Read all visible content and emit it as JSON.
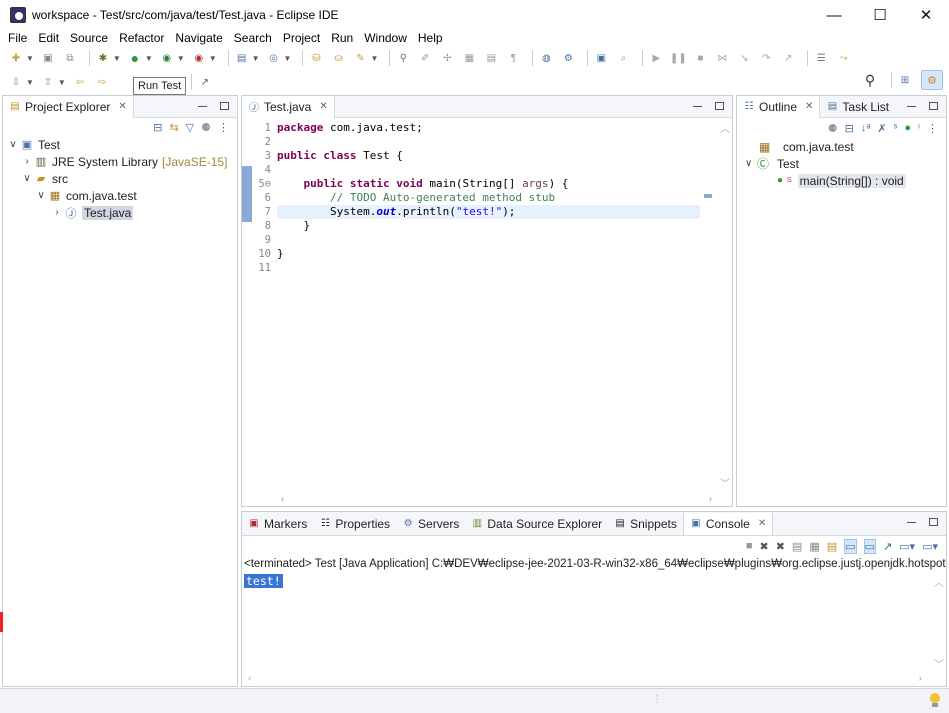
{
  "window": {
    "title": "workspace - Test/src/com/java/test/Test.java - Eclipse IDE",
    "minimize": "—",
    "maximize": "☐",
    "close": "✕"
  },
  "menu": [
    "File",
    "Edit",
    "Source",
    "Refactor",
    "Navigate",
    "Search",
    "Project",
    "Run",
    "Window",
    "Help"
  ],
  "tooltip": "Run Test",
  "project_explorer": {
    "tab_label": "Project Explorer",
    "tree": {
      "project": "Test",
      "jre": "JRE System Library",
      "jre_decoration": "[JavaSE-15]",
      "src": "src",
      "package": "com.java.test",
      "file": "Test.java"
    }
  },
  "editor": {
    "tab_label": "Test.java",
    "line_numbers": [
      "1",
      "2",
      "3",
      "4",
      "5⊖",
      "6",
      "7",
      "8",
      "9",
      "10",
      "11"
    ],
    "lines": {
      "l1_kw": "package",
      "l1_rest": " com.java.test;",
      "l3_kw": "public class",
      "l3_rest": " Test {",
      "l5_indent": "    ",
      "l5_kw": "public static void",
      "l5_rest": " main(String[] ",
      "l5_arg": "args",
      "l5_end": ") {",
      "l6_comment": "        // TODO Auto-generated method stub",
      "l7_pre": "        System.",
      "l7_out": "out",
      "l7_mid": ".println(",
      "l7_str": "\"test!\"",
      "l7_end": ");",
      "l8": "    }",
      "l10": "}"
    }
  },
  "outline": {
    "tab_label": "Outline",
    "task_tab_label": "Task List",
    "package": "com.java.test",
    "class": "Test",
    "method": "main(String[]) : void",
    "method_modifier": "S"
  },
  "bottom_tabs": {
    "markers": "Markers",
    "properties": "Properties",
    "servers": "Servers",
    "data_source": "Data Source Explorer",
    "snippets": "Snippets",
    "console": "Console"
  },
  "console": {
    "status_line": "<terminated> Test [Java Application] C:₩DEV₩eclipse-jee-2021-03-R-win32-x86_64₩eclipse₩plugins₩org.eclipse.justj.openjdk.hotspot.jre.f",
    "output": "test!"
  },
  "colors": {
    "keyword": "#7f0055",
    "comment": "#3f7f5f",
    "string": "#2a00ff",
    "static_field": "#0000c0",
    "selection": "#3875d7"
  }
}
